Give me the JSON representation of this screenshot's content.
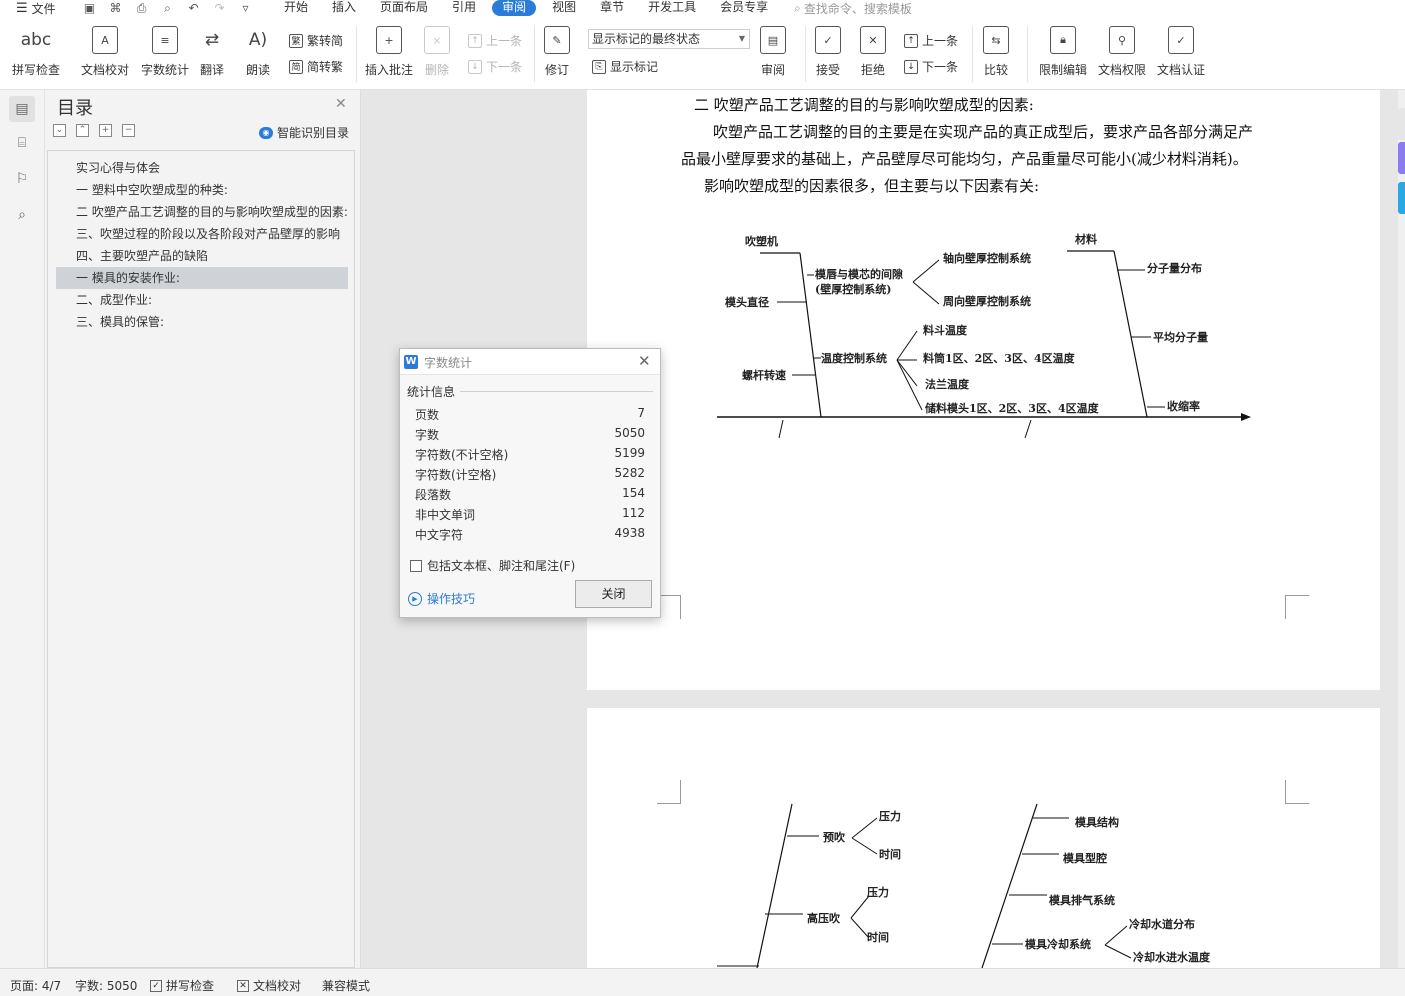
{
  "menubar": {
    "file_label": "文件",
    "tabs": [
      "开始",
      "插入",
      "页面布局",
      "引用",
      "审阅",
      "视图",
      "章节",
      "开发工具",
      "会员专享"
    ],
    "active_tab": "审阅",
    "search_placeholder": "查找命令、搜索模板"
  },
  "ribbon": {
    "spell_check": "拼写检查",
    "doc_proofread": "文档校对",
    "word_count": "字数统计",
    "translate": "翻译",
    "read_aloud": "朗读",
    "trad_to_simp": "繁转简",
    "simp_to_trad": "简转繁",
    "insert_comment": "插入批注",
    "delete": "删除",
    "prev_comment": "上一条",
    "next_comment": "下一条",
    "track_changes": "修订",
    "markup_select": "显示标记的最终状态",
    "show_markup": "显示标记",
    "review": "审阅",
    "accept": "接受",
    "reject": "拒绝",
    "prev_change": "上一条",
    "next_change": "下一条",
    "compare": "比较",
    "restrict_edit": "限制编辑",
    "doc_permission": "文档权限",
    "doc_certify": "文档认证"
  },
  "toc": {
    "title": "目录",
    "smart_toc": "智能识别目录",
    "items": [
      "实习心得与体会",
      "一 塑料中空吹塑成型的种类:",
      "二 吹塑产品工艺调整的目的与影响吹塑成型的因素:",
      "三、吹塑过程的阶段以及各阶段对产品壁厚的影响",
      "四、主要吹塑产品的缺陷",
      "一 模具的安装作业:",
      "二、成型作业:",
      "三、模具的保管:"
    ],
    "selected_index": 5
  },
  "document": {
    "heading": "二 吹塑产品工艺调整的目的与影响吹塑成型的因素:",
    "para1_line1": "吹塑产品工艺调整的目的主要是在实现产品的真正成型后，要求产品各部分满足产",
    "para1_line2": "品最小壁厚要求的基础上，产品壁厚尽可能均匀，产品重量尽可能小(减少材料消耗)。",
    "para2": "影响吹塑成型的因素很多，但主要与以下因素有关:",
    "diagram1": {
      "machine": "吹塑机",
      "material": "材料",
      "gap1": "模唇与模芯的间隙",
      "gap2": "(壁厚控制系统)",
      "axial": "轴向壁厚控制系统",
      "radial": "周向壁厚控制系统",
      "head_diameter": "模头直径",
      "hopper_temp": "料斗温度",
      "temp_ctrl": "温度控制系统",
      "barrel_temp": "料筒1区、2区、3区、4区温度",
      "flange_temp": "法兰温度",
      "screw_speed": "螺杆转速",
      "storage_temp": "储料模头1区、2区、3区、4区温度",
      "mol_dist": "分子量分布",
      "avg_mol": "平均分子量",
      "shrink": "收缩率"
    },
    "diagram2": {
      "preblow": "预吹",
      "pressure": "压力",
      "time": "时间",
      "highblow": "高压吹",
      "mold_struct": "模具结构",
      "mold_cavity": "模具型腔",
      "mold_vent": "模具排气系统",
      "mold_cool": "模具冷却系统",
      "coolant_dist": "冷却水道分布",
      "coolant_in_temp": "冷却水进水温度"
    }
  },
  "dialog": {
    "title": "字数统计",
    "section": "统计信息",
    "rows": [
      {
        "k": "页数",
        "v": "7"
      },
      {
        "k": "字数",
        "v": "5050"
      },
      {
        "k": "字符数(不计空格)",
        "v": "5199"
      },
      {
        "k": "字符数(计空格)",
        "v": "5282"
      },
      {
        "k": "段落数",
        "v": "154"
      },
      {
        "k": "非中文单词",
        "v": "112"
      },
      {
        "k": "中文字符",
        "v": "4938"
      }
    ],
    "include_label": "包括文本框、脚注和尾注(F)",
    "tips": "操作技巧",
    "close": "关闭"
  },
  "statusbar": {
    "page": "页面: 4/7",
    "words": "字数: 5050",
    "spell": "拼写检查",
    "proof": "文档校对",
    "compat": "兼容模式"
  },
  "colors": {
    "accent": "#2b7bd8",
    "selected_toc": "#cfd3d8"
  }
}
